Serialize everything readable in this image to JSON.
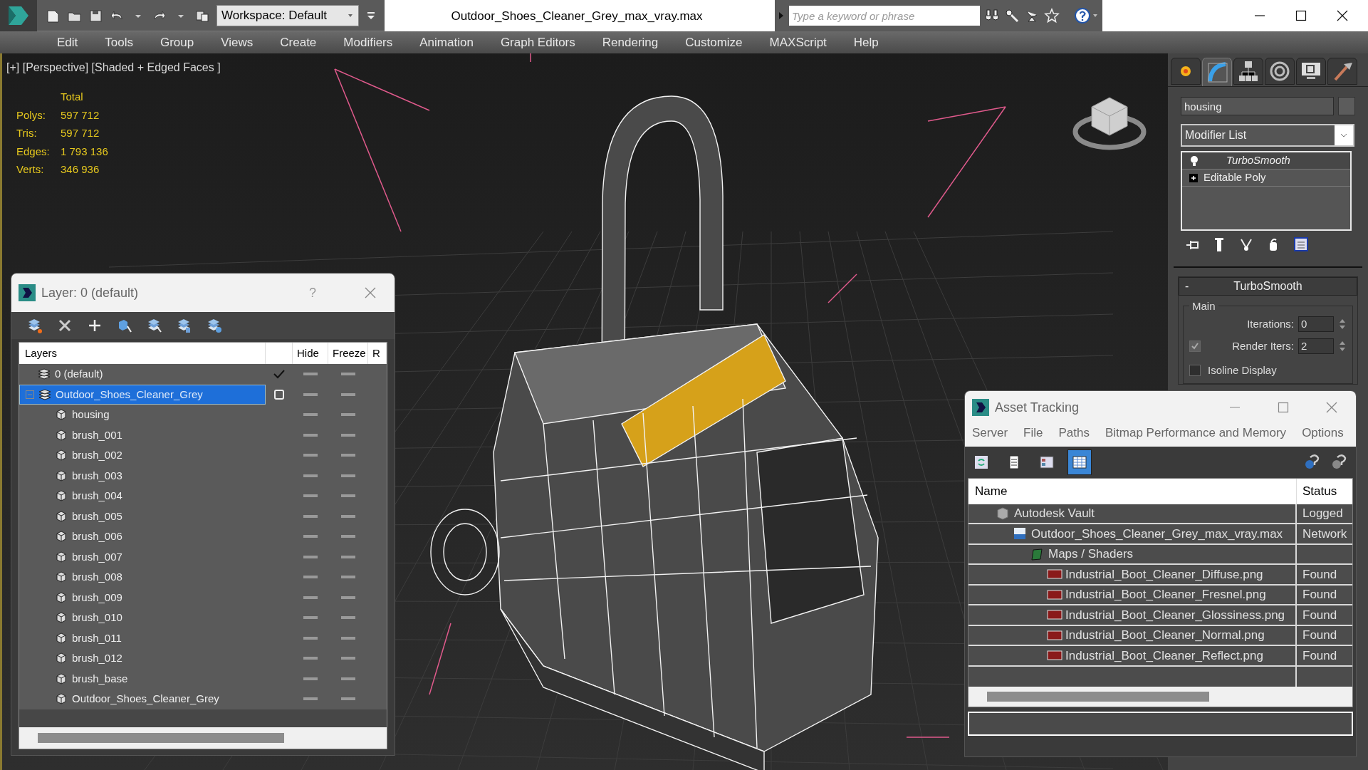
{
  "app": {
    "workspace": "Workspace: Default",
    "title": "Outdoor_Shoes_Cleaner_Grey_max_vray.max",
    "search": {
      "placeholder": "Type a keyword or phrase"
    }
  },
  "menu": [
    "Edit",
    "Tools",
    "Group",
    "Views",
    "Create",
    "Modifiers",
    "Animation",
    "Graph Editors",
    "Rendering",
    "Customize",
    "MAXScript",
    "Help"
  ],
  "viewport": {
    "label": "[+] [Perspective] [Shaded + Edged Faces ]",
    "stats": {
      "heading": "Total",
      "rows": [
        {
          "label": "Polys:",
          "value": "597 712"
        },
        {
          "label": "Tris:",
          "value": "597 712"
        },
        {
          "label": "Edges:",
          "value": "1 793 136"
        },
        {
          "label": "Verts:",
          "value": "346 936"
        }
      ]
    }
  },
  "command_panel": {
    "tabs": [
      {
        "kind": "create",
        "selected": false
      },
      {
        "kind": "modify",
        "selected": true
      },
      {
        "kind": "hierarchy",
        "selected": false
      },
      {
        "kind": "motion",
        "selected": false
      },
      {
        "kind": "display",
        "selected": false
      },
      {
        "kind": "utilities",
        "selected": false
      }
    ],
    "object_name": "housing",
    "modifier_list": "Modifier List",
    "stack": [
      {
        "kind": "modifier",
        "label": "TurboSmooth"
      },
      {
        "kind": "base",
        "label": "Editable Poly"
      }
    ],
    "rollout": {
      "collapse_symbol": "-",
      "title": "TurboSmooth",
      "group": "Main",
      "iterations": {
        "label": "Iterations:",
        "value": "0"
      },
      "render_iters": {
        "label": "Render Iters:",
        "value": "2",
        "checked": true
      },
      "isoline": {
        "label": "Isoline Display",
        "checked": false
      }
    }
  },
  "layer_dialog": {
    "title": "Layer: 0 (default)",
    "help": "?",
    "columns": [
      "Layers",
      "Hide",
      "Freeze",
      "R"
    ],
    "layers": [
      {
        "name": "0 (default)",
        "current": true,
        "selected": false
      },
      {
        "name": "Outdoor_Shoes_Cleaner_Grey",
        "current": false,
        "selected": true,
        "expanded": true,
        "children": [
          {
            "name": "housing"
          },
          {
            "name": "brush_001"
          },
          {
            "name": "brush_002"
          },
          {
            "name": "brush_003"
          },
          {
            "name": "brush_004"
          },
          {
            "name": "brush_005"
          },
          {
            "name": "brush_006"
          },
          {
            "name": "brush_007"
          },
          {
            "name": "brush_008"
          },
          {
            "name": "brush_009"
          },
          {
            "name": "brush_010"
          },
          {
            "name": "brush_011"
          },
          {
            "name": "brush_012"
          },
          {
            "name": "brush_base"
          },
          {
            "name": "Outdoor_Shoes_Cleaner_Grey"
          }
        ]
      }
    ]
  },
  "asset_tracking": {
    "title": "Asset Tracking",
    "menu": [
      "Server",
      "File",
      "Paths",
      "Bitmap Performance and Memory",
      "Options"
    ],
    "toolbar": [
      {
        "kind": "refresh",
        "selected": false
      },
      {
        "kind": "list",
        "selected": false
      },
      {
        "kind": "thumbnails",
        "selected": false
      },
      {
        "kind": "table",
        "selected": true
      }
    ],
    "columns": [
      "Name",
      "Status"
    ],
    "rows": [
      {
        "kind": "vault",
        "name": "Autodesk Vault",
        "status": "Logged",
        "children": [
          {
            "kind": "max",
            "name": "Outdoor_Shoes_Cleaner_Grey_max_vray.max",
            "status": "Network",
            "children": [
              {
                "kind": "maps",
                "name": "Maps / Shaders",
                "children": [
                  {
                    "kind": "png",
                    "name": "Industrial_Boot_Cleaner_Diffuse.png",
                    "status": "Found"
                  },
                  {
                    "kind": "png",
                    "name": "Industrial_Boot_Cleaner_Fresnel.png",
                    "status": "Found"
                  },
                  {
                    "kind": "png",
                    "name": "Industrial_Boot_Cleaner_Glossiness.png",
                    "status": "Found"
                  },
                  {
                    "kind": "png",
                    "name": "Industrial_Boot_Cleaner_Normal.png",
                    "status": "Found"
                  },
                  {
                    "kind": "png",
                    "name": "Industrial_Boot_Cleaner_Reflect.png",
                    "status": "Found"
                  }
                ]
              }
            ]
          }
        ]
      }
    ]
  }
}
